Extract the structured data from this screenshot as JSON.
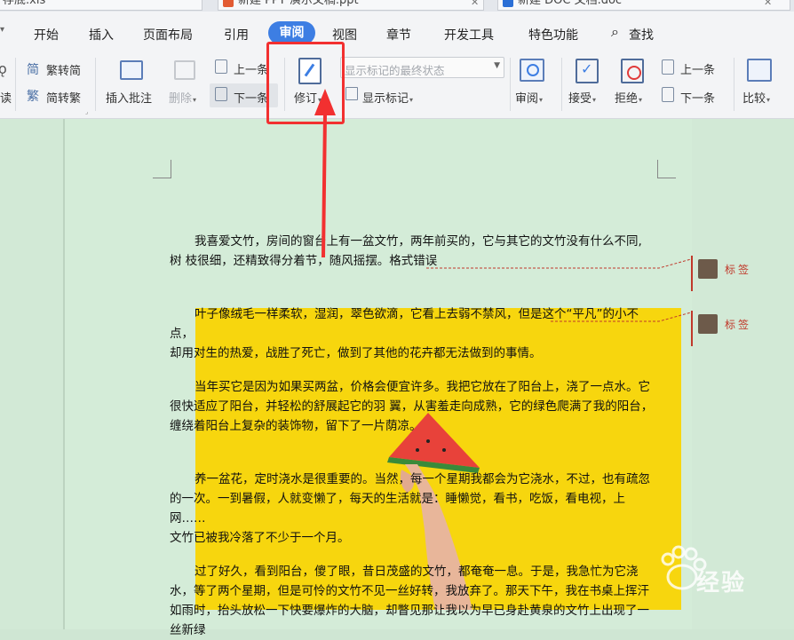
{
  "tabs": [
    {
      "label": "存底.xls",
      "color": "#1e9e58"
    },
    {
      "label": "新建 PPT 演示文稿.ppt",
      "color": "#e25b33"
    },
    {
      "label": "新建 DOC 文档.doc",
      "color": "#2b6fd6"
    }
  ],
  "menu": [
    "开始",
    "插入",
    "页面布局",
    "引用",
    "审阅",
    "视图",
    "章节",
    "开发工具",
    "特色功能",
    "查找"
  ],
  "ribbon": {
    "trad": "繁转简",
    "simp": "简转繁",
    "read": "读",
    "insert_comment": "插入批注",
    "delete": "删除",
    "prev1": "上一条",
    "next1": "下一条",
    "revise": "修订",
    "display_mode": "显示标记的最终状态",
    "show_markup": "显示标记",
    "review": "审阅",
    "accept": "接受",
    "reject": "拒绝",
    "prev2": "上一条",
    "next2": "下一条",
    "compare": "比较"
  },
  "document": {
    "p1": "我喜爱文竹，房间的窗台上有一盆文竹，两年前买的，它与其它的文竹没有什么不同,",
    "p1b": "树         枝很细，还精致得分着节，随风摇摆。格式错误",
    "p2": "叶子像绒毛一样柔软，湿润，翠色欲滴，它看上去弱不禁风，但是这个“平凡”的小不点，",
    "p2b": "却用对生的热爱，战胜了死亡，做到了其他的花卉都无法做到的事情。",
    "p3": "当年买它是因为如果买两盆，价格会便宜许多。我把它放在了阳台上，浇了一点水。它",
    "p3b": "很快适应了阳台，并轻松的舒展起它的羽  翼，从害羞走向成熟，它的绿色爬满了我的阳台，",
    "p3c": "缠绕着阳台上复杂的装饰物，留下了一片荫凉。",
    "p4": "养一盆花，定时浇水是很重要的。当然，每一个星期我都会为它浇水，不过，也有疏忽",
    "p4b": "的一次。一到暑假，人就变懒了，每天的生活就是：睡懒觉，看书，吃饭，看电视，上网……",
    "p4c": "文竹已被我冷落了不少于一个月。",
    "p5": "过了好久，看到阳台，傻了眼，昔日茂盛的文竹，都奄奄一息。于是，我急忙为它浇",
    "p5b": "水，等了两个星期，但是可怜的文竹不见一丝好转，我放弃了。那天下午，我在书桌上挥汗",
    "p5c": "如雨时，抬头放松一下快要爆炸的大脑，却瞥见那让我以为早已身赴黄泉的文竹上出现了一",
    "p5d": "丝新绿"
  },
  "comments": [
    {
      "label": "标签"
    },
    {
      "label": "标签"
    }
  ],
  "watermark": {
    "brand": "经验"
  },
  "colors": {
    "accent": "#3d7ee3",
    "highlight": "#f23030",
    "revision": "#c0392b"
  }
}
